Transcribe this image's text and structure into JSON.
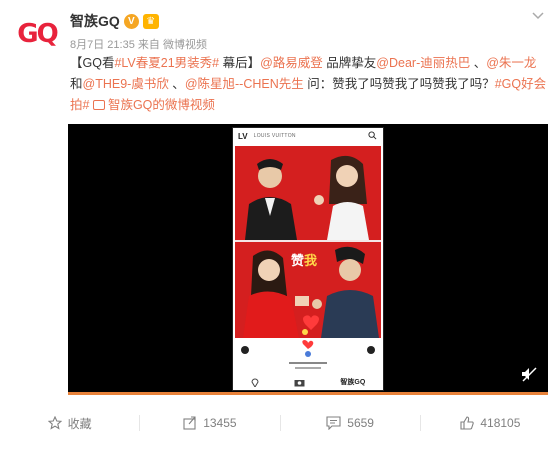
{
  "author": {
    "avatar_text": "GQ",
    "name": "智族GQ",
    "verified_badge": "V"
  },
  "meta": {
    "date": "8月7日 21:35",
    "source": "来自 微博视频"
  },
  "post": {
    "t1": "【GQ看",
    "tag1": "#LV春夏21男装秀#",
    "t2": " 幕后】",
    "mention1": "@路易威登",
    "t3": " 品牌挚友",
    "mention2": "@Dear-迪丽热巴",
    "t4": " 、",
    "mention3": "@朱一龙",
    "t5": " 和",
    "mention4": "@THE9-虞书欣",
    "t6": " 、",
    "mention5": "@陈星旭--CHEN先生",
    "t7": " 问：赞我了吗赞我了吗赞我了吗？",
    "tag2": "#GQ好会拍#",
    "video_link": "智族GQ的微博视频"
  },
  "video": {
    "phone_logo": "LV",
    "phone_brand": "LOUIS VUITTON",
    "zan_left": "赞",
    "zan_right": "我",
    "phone_footer_logo": "智族GQ"
  },
  "actions": {
    "favorite_label": "收藏",
    "repost_count": "13455",
    "comment_count": "5659",
    "like_count": "418105"
  },
  "colors": {
    "link": "#eb7350",
    "gq_red": "#e8233c",
    "video_bg": "#000000",
    "progress": "#e8823a"
  }
}
